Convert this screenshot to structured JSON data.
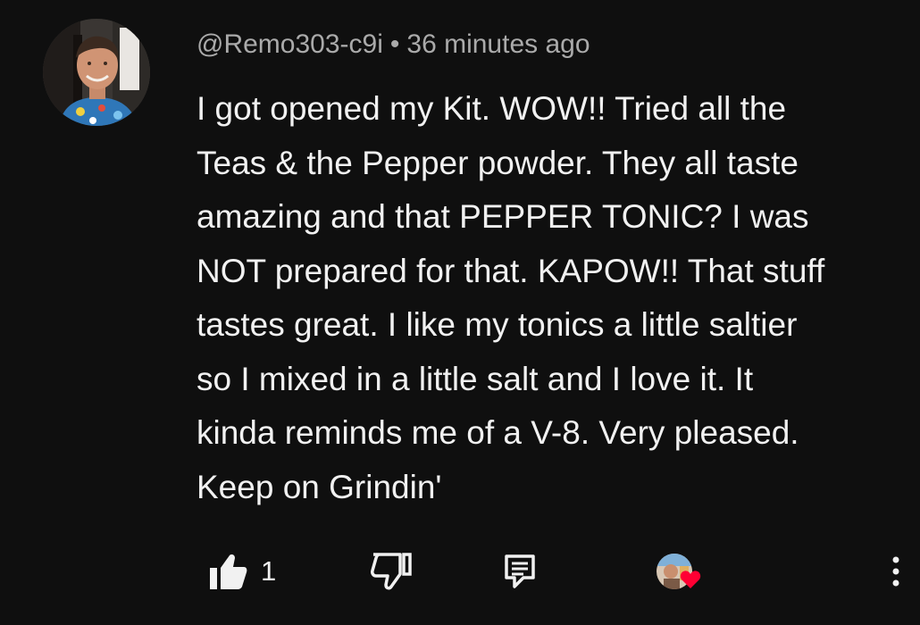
{
  "comment": {
    "author": "@Remo303-c9i",
    "separator": "•",
    "timestamp": "36 minutes ago",
    "lines": [
      "I got opened my Kit. WOW!! Tried all the",
      "Teas & the Pepper powder. They all taste",
      "amazing and that PEPPER TONIC? I was",
      "NOT prepared for that. KAPOW!! That stuff",
      "tastes great. I like my tonics a little saltier",
      "so I mixed in a little salt and I love it. It",
      "kinda reminds me of a V-8. Very pleased.",
      "Keep on Grindin'"
    ],
    "like_count": "1"
  },
  "icons": {
    "like": "thumbs-up-icon",
    "dislike": "thumbs-down-icon",
    "reply": "comment-reply-icon",
    "creator_heart": "creator-heart-icon",
    "more": "more-vertical-icon"
  },
  "colors": {
    "background": "#0f0f0f",
    "text": "#f1f1f1",
    "meta": "#aaaaaa",
    "heart": "#ff0033"
  }
}
